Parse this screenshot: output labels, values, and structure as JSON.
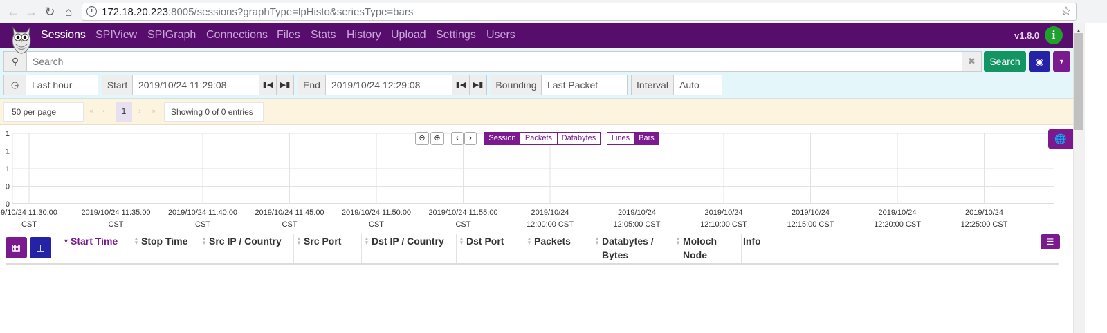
{
  "browser": {
    "url_host": "172.18.20.223",
    "url_rest": ":8005/sessions?graphType=lpHisto&seriesType=bars"
  },
  "nav": {
    "items": [
      "Sessions",
      "SPIView",
      "SPIGraph",
      "Connections",
      "Files",
      "Stats",
      "History",
      "Upload",
      "Settings",
      "Users"
    ],
    "active": "Sessions",
    "version": "v1.8.0",
    "help_icon": "info-icon"
  },
  "search": {
    "placeholder": "Search",
    "button_label": "Search",
    "time_range": "Last hour",
    "start_label": "Start",
    "start_value": "2019/10/24 11:29:08",
    "end_label": "End",
    "end_value": "2019/10/24 12:29:08",
    "bounding_label": "Bounding",
    "bounding_value": "Last Packet",
    "interval_label": "Interval",
    "interval_value": "Auto"
  },
  "pagination": {
    "per_page": "50 per page",
    "current_page": "1",
    "showing": "Showing 0 of 0 entries"
  },
  "chart_controls": {
    "metric_options": [
      "Session",
      "Packets",
      "Databytes"
    ],
    "metric_selected": "Session",
    "series_options": [
      "Lines",
      "Bars"
    ],
    "series_selected": "Bars"
  },
  "chart_data": {
    "type": "bar",
    "y_ticks": [
      "1",
      "1",
      "1",
      "0",
      "0"
    ],
    "x_ticks": [
      [
        "9/10/24 11:30:00",
        "CST"
      ],
      [
        "2019/10/24 11:35:00",
        "CST"
      ],
      [
        "2019/10/24 11:40:00",
        "CST"
      ],
      [
        "2019/10/24 11:45:00",
        "CST"
      ],
      [
        "2019/10/24 11:50:00",
        "CST"
      ],
      [
        "2019/10/24 11:55:00",
        "CST"
      ],
      [
        "2019/10/24",
        "12:00:00 CST"
      ],
      [
        "2019/10/24",
        "12:05:00 CST"
      ],
      [
        "2019/10/24",
        "12:10:00 CST"
      ],
      [
        "2019/10/24",
        "12:15:00 CST"
      ],
      [
        "2019/10/24",
        "12:20:00 CST"
      ],
      [
        "2019/10/24",
        "12:25:00 CST"
      ]
    ],
    "values": [],
    "grid": true
  },
  "table": {
    "columns": [
      {
        "label": "Start Time",
        "sorted": true
      },
      {
        "label": "Stop Time",
        "sorted": false
      },
      {
        "label": "Src IP / Country",
        "sorted": false
      },
      {
        "label": "Src Port",
        "sorted": false
      },
      {
        "label": "Dst IP / Country",
        "sorted": false
      },
      {
        "label": "Dst Port",
        "sorted": false
      },
      {
        "label": "Packets",
        "sorted": false
      },
      {
        "label": "Databytes / Bytes",
        "sorted": false
      },
      {
        "label": "Moloch Node",
        "sorted": false
      },
      {
        "label": "Info",
        "sorted": false
      }
    ]
  },
  "colors": {
    "brand": "#560d6b",
    "accent": "#7b1a8f",
    "search_button": "#129463",
    "eye_button": "#2522a6"
  }
}
